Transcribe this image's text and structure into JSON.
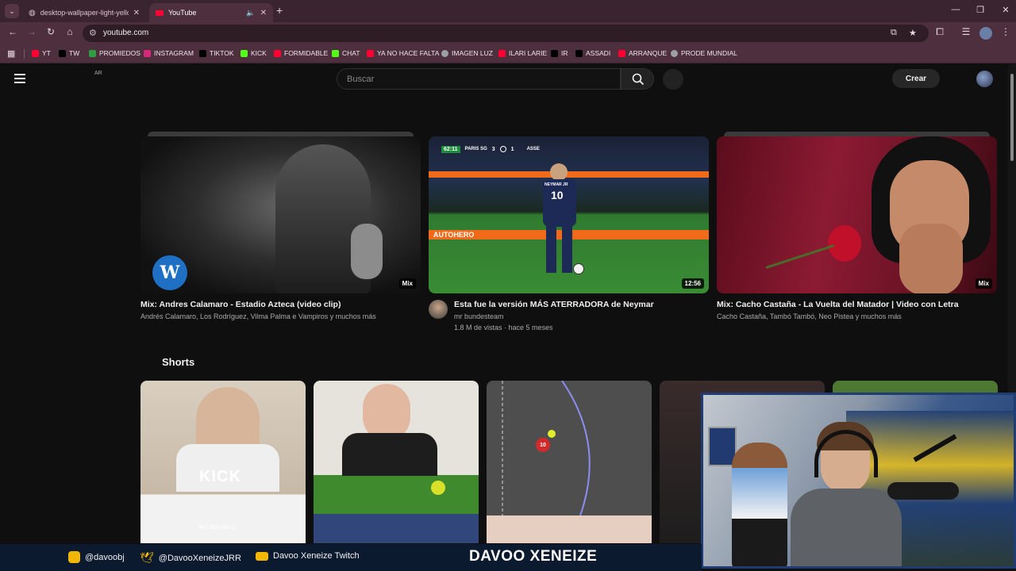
{
  "browser": {
    "tabs": [
      {
        "label": "desktop-wallpaper-light-yellow",
        "active": false
      },
      {
        "label": "YouTube",
        "active": true
      }
    ],
    "url": "youtube.com",
    "bookmarks": [
      {
        "label": "YT",
        "icon": "youtube-icon",
        "color": "#ff0033"
      },
      {
        "label": "TW",
        "icon": "x-icon",
        "color": "#000000"
      },
      {
        "label": "PROMIEDOS",
        "icon": "promiedos-icon",
        "color": "#2e9e44"
      },
      {
        "label": "INSTAGRAM",
        "icon": "instagram-icon",
        "color": "#d6287b"
      },
      {
        "label": "TIKTOK",
        "icon": "tiktok-icon",
        "color": "#000000"
      },
      {
        "label": "KICK",
        "icon": "kick-icon",
        "color": "#53fc18"
      },
      {
        "label": "FORMIDABLE",
        "icon": "youtube-icon",
        "color": "#ff0033"
      },
      {
        "label": "CHAT",
        "icon": "kick-icon",
        "color": "#53fc18"
      },
      {
        "label": "YA NO HACE FALTA",
        "icon": "youtube-icon",
        "color": "#ff0033"
      },
      {
        "label": "IMAGEN LUZ",
        "icon": "globe-icon",
        "color": "#9aa0a6"
      },
      {
        "label": "ILARI LARIE",
        "icon": "youtube-icon",
        "color": "#ff0033"
      },
      {
        "label": "IR",
        "icon": "mk-icon",
        "color": "#000000"
      },
      {
        "label": "ASSADI",
        "icon": "x-icon",
        "color": "#000000"
      },
      {
        "label": "ARRANQUE",
        "icon": "youtube-icon",
        "color": "#ff0033"
      },
      {
        "label": "PRODE MUNDIAL",
        "icon": "globe-icon",
        "color": "#9aa0a6"
      }
    ]
  },
  "youtube": {
    "region": "AR",
    "search_placeholder": "Buscar",
    "create_label": "Crear",
    "videos": [
      {
        "title": "Mix: Andres Calamaro - Estadio Azteca (video clip)",
        "meta1": "Andrés Calamaro, Los Rodríguez, Vilma Palma e Vampiros y muchos más",
        "meta2": "",
        "badge": "Mix",
        "has_channel_avatar": false
      },
      {
        "title": "Esta fue la versión MÁS ATERRADORA de Neymar",
        "meta1": "mr bundesteam",
        "meta2": "1.8 M de vistas · hace 5 meses",
        "badge": "12:56",
        "has_channel_avatar": true,
        "scoreboard": {
          "time": "62:11",
          "home": "PARIS SG",
          "home_score": "3",
          "away_score": "1",
          "away": "ASSE"
        },
        "jersey": {
          "name": "NEYMAR JR",
          "number": "10"
        },
        "ad_text": "AUTOHERO"
      },
      {
        "title": "Mix: Cacho Castaña - La Vuelta del Matador | Video con Letra",
        "meta1": "Cacho Castaña, Tambó Tambó, Neo Pistea y muchos más",
        "meta2": "",
        "badge": "Mix",
        "has_channel_avatar": false
      }
    ],
    "shorts_title": "Shorts",
    "shorts_texts": {
      "kick_watermark": "KICK",
      "caption": "Test del fallo 9",
      "ball_number": "10"
    }
  },
  "stream_overlay": {
    "instagram": "@davoobj",
    "twitter": "@DavooXeneizeJRR",
    "youtube": "Davoo Xeneize Twitch",
    "streamer_name": "DAVOO XENEIZE"
  }
}
